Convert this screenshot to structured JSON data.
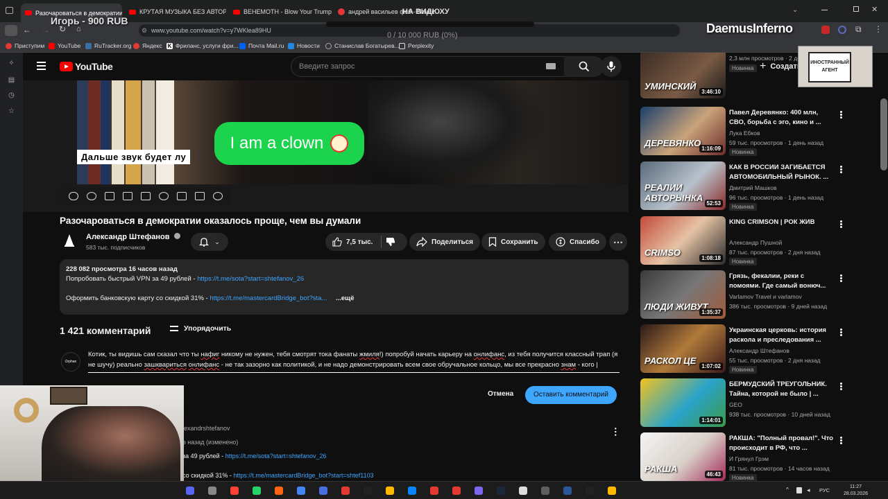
{
  "browser": {
    "tabs": [
      {
        "label": "Разочароваться в демократии",
        "active": true
      },
      {
        "label": "КРУТАЯ МУЗЫКА БЕЗ АВТОРСКОГО"
      },
      {
        "label": "ВЕНЕМОТН - Blow Your Trumpets"
      },
      {
        "label": "андрей васильев фсб - Поиск"
      }
    ],
    "url": "www.youtube.com/watch?v=y7WKlea89HU",
    "bookmarks": [
      "Приступим",
      "YouTube",
      "RuTracker.org",
      "Яндекс",
      "Фриланс, услуги фри...",
      "Почта Mail.ru",
      "Новости",
      "Станислав Богатырев...",
      "Perplexity"
    ]
  },
  "overlays": {
    "streamer_name": "Игорь - 900 RUB",
    "widget_title": "НА ВИДЮХУ",
    "widget_progress": "0 / 10 000 RUB (0%)",
    "streamer_logo": "DaemusInferno",
    "stamp_text": "ИНОСТРАННЫЙ АГЕНТ"
  },
  "youtube": {
    "logo": "YouTube",
    "search_placeholder": "Введите запрос",
    "create_label": "Создать",
    "video": {
      "subtitle": "Дальше звук будет лу",
      "bubble_text": "I am a clown",
      "title": "Разочароваться в демократии оказалось проще, чем вы думали",
      "channel": "Александр Штефанов",
      "subscribers": "583 тыс. подписчиков",
      "likes": "7,5 тыс.",
      "share": "Поделиться",
      "save": "Сохранить",
      "thanks": "Спасибо"
    },
    "description": {
      "stats": "228 082 просмотра  16 часов назад",
      "line1_text": "Попробовать быстрый VPN за 49 рублей - ",
      "line1_link": "https://t.me/sota?start=shtefanov_26",
      "line2_text": "Оформить банковскую карту со скидкой 31% - ",
      "line2_link": "https://t.me/mastercardBridge_bot?sta...",
      "more": "...ещё"
    },
    "comments": {
      "count": "1 421 комментарий",
      "sort": "Упорядочить",
      "avatar_label": "Orphan",
      "draft": [
        {
          "t": "Котик, ты видишь сам сказал что ты "
        },
        {
          "t": "нафиг",
          "spell": true
        },
        {
          "t": " никому не нужен, тебя смотрят тока фанаты "
        },
        {
          "t": "жмиля",
          "spell": true
        },
        {
          "t": "!) попробуй начать карьеру на "
        },
        {
          "t": "онлифанс",
          "spell": true
        },
        {
          "t": ", из тебя получится классный трап (я не шучу) реально "
        },
        {
          "t": "зашквариться",
          "spell": true
        },
        {
          "t": " "
        },
        {
          "t": "онлифанс",
          "spell": true
        },
        {
          "t": " - не так зазорно как политикой, и не надо демонстрировать всем свое обручальное кольцо, мы все прекрасно "
        },
        {
          "t": "знам",
          "spell": true
        },
        {
          "t": " - кого |"
        }
      ],
      "cancel": "Отмена",
      "post": "Оставить комментарий",
      "pinned": {
        "author": "lexandrshtefanov",
        "time": "в назад (изменено)",
        "line1_text": "за 49 рублей - ",
        "line1_link": "https://t.me/sota?start=shtefanov_26",
        "line2_text": "со скидкой 31% - ",
        "line2_link": "https://t.me/mastercardBridge_bot?start=shtef1103"
      }
    },
    "sidebar": [
      {
        "title": "",
        "channel": "",
        "meta": "2,3 млн просмотров · 2 дня назад",
        "badge": "Новинка",
        "duration": "3:46:10",
        "thumb_label": "УМИНСКИЙ"
      },
      {
        "title": "Павел Деревянко: 400 млн, СВО, борьба с эго, кино и ...",
        "channel": "Лука Ебков",
        "meta": "59 тыс. просмотров · 1 день назад",
        "badge": "Новинка",
        "duration": "1:16:09",
        "thumb_label": "ДЕРЕВЯНКО"
      },
      {
        "title": "КАК В РОССИИ ЗАГИБАЕТСЯ АВТОМОБИЛЬНЫЙ РЫНОК. ...",
        "channel": "Дмитрий Машков",
        "meta": "96 тыс. просмотров · 1 день назад",
        "badge": "Новинка",
        "duration": "52:53",
        "thumb_label": "РЕАЛИИ АВТОРЫНКА"
      },
      {
        "title": "KING CRIMSON | РОК ЖИВ",
        "channel": "Александр Пушной",
        "meta": "87 тыс. просмотров · 2 дня назад",
        "badge": "Новинка",
        "duration": "1:08:18",
        "thumb_label": "CRIMSO"
      },
      {
        "title": "Грязь, фекалии, реки с помоями. Где самый вонюч...",
        "channel": "Varlamov Travel и varlamov",
        "meta": "386 тыс. просмотров · 9 дней назад",
        "badge": "",
        "duration": "1:35:37",
        "thumb_label": "ЛЮДИ ЖИВУТ"
      },
      {
        "title": "Украинская церковь: история раскола и преследования ...",
        "channel": "Александр Штефанов",
        "meta": "55 тыс. просмотров · 2 дня назад",
        "badge": "Новинка",
        "duration": "1:07:02",
        "thumb_label": "РАСКОЛ ЦЕ"
      },
      {
        "title": "БЕРМУДСКИЙ ТРЕУГОЛЬНИК. Тайна, которой не было | ...",
        "channel": "GEO",
        "meta": "938 тыс. просмотров · 10 дней назад",
        "badge": "",
        "duration": "1:14:01",
        "thumb_label": ""
      },
      {
        "title": "РАКША: \"Полный провал!\". Что происходит в РФ, что ...",
        "channel": "И Грянул Грэм",
        "meta": "81 тыс. просмотров · 14 часов назад",
        "badge": "Новинка",
        "duration": "46:43",
        "thumb_label": "РАКША"
      }
    ]
  },
  "taskbar": {
    "lang": "РУС",
    "time": "11:27",
    "date": "28.03.2026"
  }
}
